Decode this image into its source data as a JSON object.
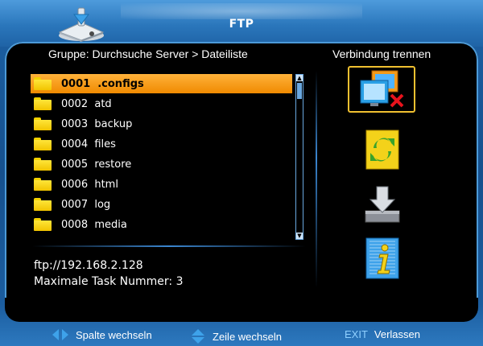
{
  "header": {
    "title": "FTP"
  },
  "breadcrumb": "Gruppe: Durchsuche Server > Dateiliste",
  "disconnect_label": "Verbindung trennen",
  "files": [
    {
      "label": "0001  .configs",
      "selected": true
    },
    {
      "label": "0002  atd",
      "selected": false
    },
    {
      "label": "0003  backup",
      "selected": false
    },
    {
      "label": "0004  files",
      "selected": false
    },
    {
      "label": "0005  restore",
      "selected": false
    },
    {
      "label": "0006  html",
      "selected": false
    },
    {
      "label": "0007  log",
      "selected": false
    },
    {
      "label": "0008  media",
      "selected": false
    }
  ],
  "info": {
    "server": "ftp://192.168.2.128",
    "task": "Maximale Task Nummer: 3"
  },
  "actions": [
    {
      "icon": "disconnect-icon"
    },
    {
      "icon": "refresh-icon"
    },
    {
      "icon": "download-icon"
    },
    {
      "icon": "info-icon"
    }
  ],
  "footer": {
    "column_label": "Spalte wechseln",
    "row_label": "Zeile wechseln",
    "exit_key": "EXIT",
    "exit_label": "Verlassen"
  },
  "colors": {
    "accent_orange": "#f08a00",
    "folder_yellow": "#ffe53a",
    "frame_blue": "#1b5d9f"
  }
}
